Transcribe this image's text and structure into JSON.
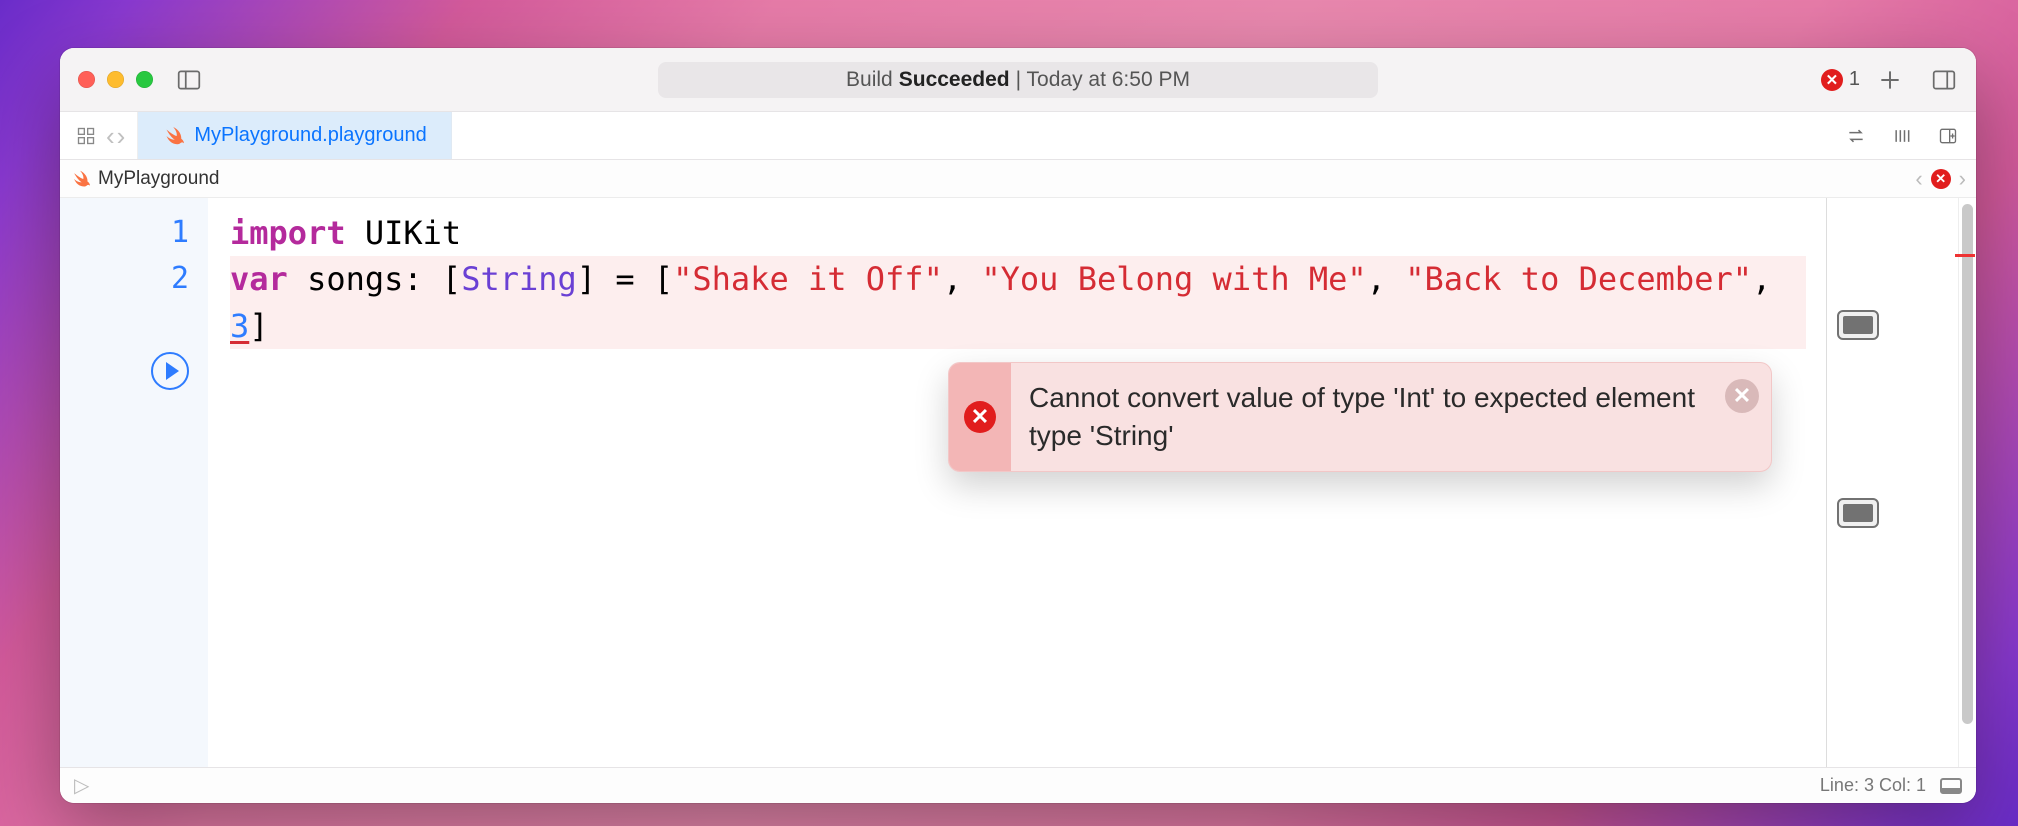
{
  "titlebar": {
    "status_prefix": "Build ",
    "status_bold": "Succeeded",
    "status_suffix": " | Today at 6:50 PM",
    "error_count": "1"
  },
  "tab": {
    "filename": "MyPlayground.playground"
  },
  "breadcrumb": {
    "name": "MyPlayground"
  },
  "code": {
    "lines": {
      "l1": "1",
      "l2": "2"
    },
    "import_kw": "import",
    "uikit": "UIKit",
    "var_kw": "var",
    "songs": "songs",
    "colon": ": [",
    "string_type": "String",
    "close_open": "] = [",
    "s1": "\"Shake it Off\"",
    "comma1": ", ",
    "s2": "\"You Belong with Me\"",
    "comma2": ", ",
    "s3": "\"Back to December\"",
    "comma3": ", ",
    "errnum": "3",
    "close": "]"
  },
  "error": {
    "message": "Cannot convert value of type 'Int' to expected element type 'String'",
    "badge": "✕",
    "close": "✕"
  },
  "statusbar": {
    "cursor": "Line: 3  Col: 1"
  }
}
